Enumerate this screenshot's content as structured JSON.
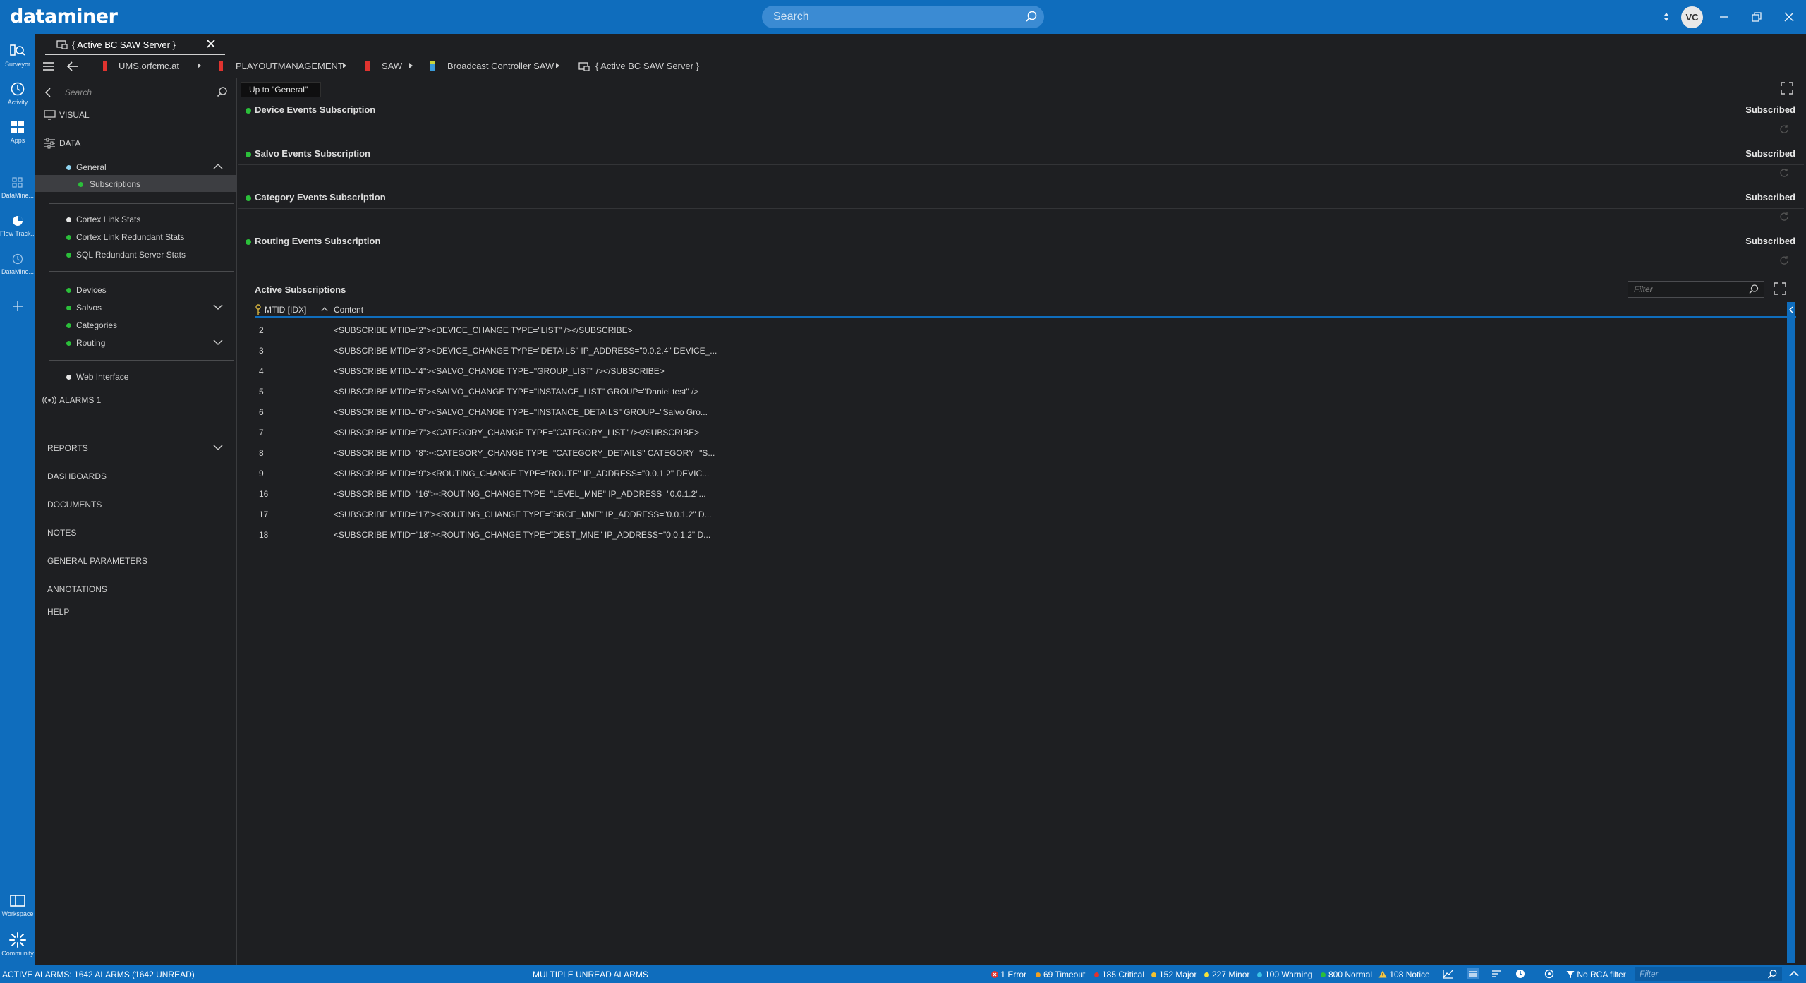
{
  "app": {
    "logo": "dataminer",
    "search_placeholder": "Search",
    "user_initials": "VC"
  },
  "rail": [
    {
      "label": "Surveyor",
      "icon": "surveyor-icon"
    },
    {
      "label": "Activity",
      "icon": "activity-icon"
    },
    {
      "label": "Apps",
      "icon": "apps-icon"
    },
    {
      "label": "DataMine...",
      "icon": "datamine-icon"
    },
    {
      "label": "Flow Track...",
      "icon": "flow-tracking-icon"
    },
    {
      "label": "DataMine...",
      "icon": "history-icon"
    },
    {
      "label": "Workspace",
      "icon": "workspace-icon"
    },
    {
      "label": "Community",
      "icon": "community-icon"
    }
  ],
  "tab": {
    "title": "{ Active BC SAW Server }"
  },
  "breadcrumb": [
    {
      "label": "UMS.orfcmc.at",
      "color": "#e0332f"
    },
    {
      "label": "PLAYOUTMANAGEMENT",
      "color": "#e0332f"
    },
    {
      "label": "SAW",
      "color": "#e0332f"
    },
    {
      "label": "Broadcast Controller SAW",
      "color": "#3a9ad9"
    },
    {
      "label": "{ Active BC SAW Server }",
      "color": "#cfcfcf"
    }
  ],
  "nav": {
    "search_placeholder": "Search",
    "visual": "VISUAL",
    "data": "DATA",
    "general": "General",
    "subscriptions": "Subscriptions",
    "cortex_link_stats": "Cortex Link Stats",
    "cortex_link_redundant": "Cortex Link Redundant Stats",
    "sql_redundant": "SQL Redundant Server Stats",
    "devices": "Devices",
    "salvos": "Salvos",
    "categories": "Categories",
    "routing": "Routing",
    "web_interface": "Web Interface",
    "alarms": "ALARMS 1",
    "reports": "REPORTS",
    "dashboards": "DASHBOARDS",
    "documents": "DOCUMENTS",
    "notes": "NOTES",
    "general_parameters": "GENERAL PARAMETERS",
    "annotations": "ANNOTATIONS",
    "help": "HELP"
  },
  "main": {
    "up_to": "Up to \"General\"",
    "subscriptions": [
      {
        "name": "Device Events Subscription",
        "status": "Subscribed"
      },
      {
        "name": "Salvo Events Subscription",
        "status": "Subscribed"
      },
      {
        "name": "Category Events Subscription",
        "status": "Subscribed"
      },
      {
        "name": "Routing Events Subscription",
        "status": "Subscribed"
      }
    ],
    "active_title": "Active Subscriptions",
    "filter_placeholder": "Filter",
    "columns": [
      "MTID [IDX]",
      "Content"
    ],
    "rows": [
      {
        "id": "2",
        "content": "<SUBSCRIBE MTID=\"2\"><DEVICE_CHANGE TYPE=\"LIST\" /></SUBSCRIBE>"
      },
      {
        "id": "3",
        "content": "<SUBSCRIBE MTID=\"3\"><DEVICE_CHANGE TYPE=\"DETAILS\" IP_ADDRESS=\"0.0.2.4\" DEVICE_..."
      },
      {
        "id": "4",
        "content": "<SUBSCRIBE MTID=\"4\"><SALVO_CHANGE TYPE=\"GROUP_LIST\" /></SUBSCRIBE>"
      },
      {
        "id": "5",
        "content": "<SUBSCRIBE MTID=\"5\"><SALVO_CHANGE TYPE=\"INSTANCE_LIST\" GROUP=\"Daniel test\" />"
      },
      {
        "id": "6",
        "content": "<SUBSCRIBE MTID=\"6\"><SALVO_CHANGE TYPE=\"INSTANCE_DETAILS\" GROUP=\"Salvo Gro..."
      },
      {
        "id": "7",
        "content": "<SUBSCRIBE MTID=\"7\"><CATEGORY_CHANGE TYPE=\"CATEGORY_LIST\" /></SUBSCRIBE>"
      },
      {
        "id": "8",
        "content": "<SUBSCRIBE MTID=\"8\"><CATEGORY_CHANGE TYPE=\"CATEGORY_DETAILS\" CATEGORY=\"S..."
      },
      {
        "id": "9",
        "content": "<SUBSCRIBE MTID=\"9\"><ROUTING_CHANGE TYPE=\"ROUTE\" IP_ADDRESS=\"0.0.1.2\" DEVIC..."
      },
      {
        "id": "16",
        "content": "<SUBSCRIBE MTID=\"16\"><ROUTING_CHANGE TYPE=\"LEVEL_MNE\" IP_ADDRESS=\"0.0.1.2\"..."
      },
      {
        "id": "17",
        "content": "<SUBSCRIBE MTID=\"17\"><ROUTING_CHANGE TYPE=\"SRCE_MNE\" IP_ADDRESS=\"0.0.1.2\" D..."
      },
      {
        "id": "18",
        "content": "<SUBSCRIBE MTID=\"18\"><ROUTING_CHANGE TYPE=\"DEST_MNE\" IP_ADDRESS=\"0.0.1.2\" D..."
      }
    ]
  },
  "status": {
    "active_alarms": "ACTIVE ALARMS: 1642 ALARMS (1642 UNREAD)",
    "unread": "MULTIPLE UNREAD ALARMS",
    "counts": [
      {
        "label": "1 Error",
        "color": "#e0332f"
      },
      {
        "label": "69 Timeout",
        "color": "#f0a020"
      },
      {
        "label": "185 Critical",
        "color": "#e0332f"
      },
      {
        "label": "152 Major",
        "color": "#f2c230"
      },
      {
        "label": "227 Minor",
        "color": "#f5e23a"
      },
      {
        "label": "100 Warning",
        "color": "#3bc1e6"
      },
      {
        "label": "800 Normal",
        "color": "#2bbf3a"
      },
      {
        "label": "108 Notice",
        "color": "#f5c842"
      }
    ],
    "rca": "No RCA filter",
    "filter_placeholder": "Filter"
  },
  "colors": {
    "accent": "#0f6dbd",
    "background": "#1e1f22",
    "ok": "#2bbf3a"
  }
}
